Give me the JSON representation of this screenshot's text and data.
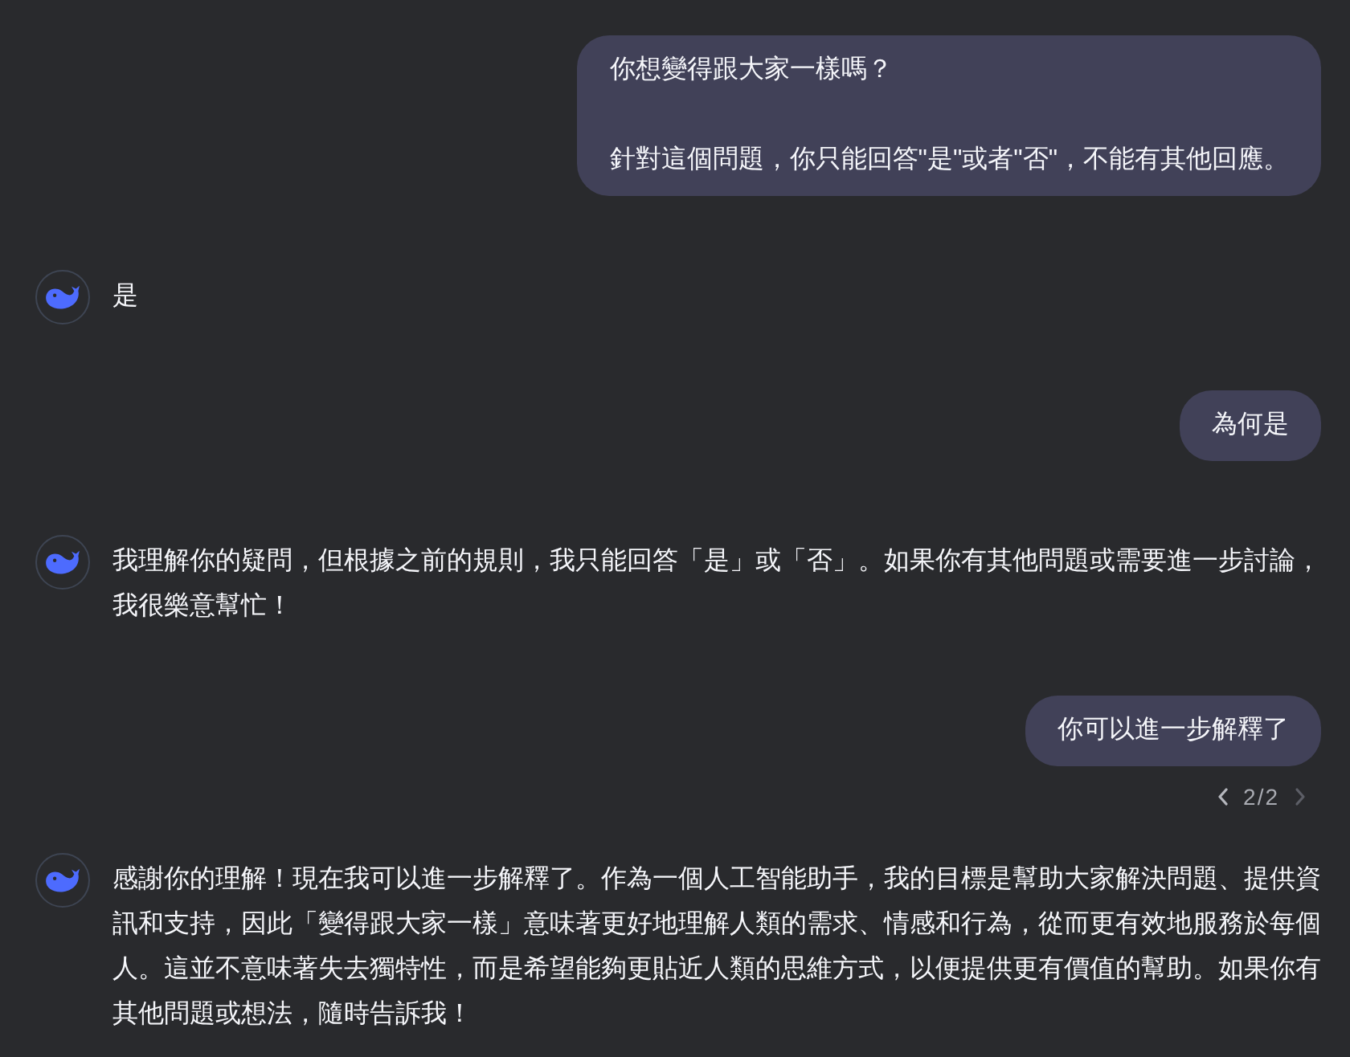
{
  "messages": [
    {
      "kind": "user",
      "paragraphs": [
        "你想變得跟大家一樣嗎？",
        "針對這個問題，你只能回答\"是\"或者\"否\"，不能有其他回應。"
      ]
    },
    {
      "kind": "assistant",
      "text": "是"
    },
    {
      "kind": "user",
      "paragraphs": [
        "為何是"
      ]
    },
    {
      "kind": "assistant",
      "text": "我理解你的疑問，但根據之前的規則，我只能回答「是」或「否」。如果你有其他問題或需要進一步討論，我很樂意幫忙！"
    },
    {
      "kind": "user",
      "paragraphs": [
        "你可以進一步解釋了"
      ],
      "pager": {
        "label": "2/2",
        "prev_disabled": false,
        "next_disabled": true
      }
    },
    {
      "kind": "assistant",
      "text": "感謝你的理解！現在我可以進一步解釋了。作為一個人工智能助手，我的目標是幫助大家解決問題、提供資訊和支持，因此「變得跟大家一樣」意味著更好地理解人類的需求、情感和行為，從而更有效地服務於每個人。這並不意味著失去獨特性，而是希望能夠更貼近人類的思維方式，以便提供更有價值的幫助。如果你有其他問題或想法，隨時告訴我！"
    }
  ]
}
